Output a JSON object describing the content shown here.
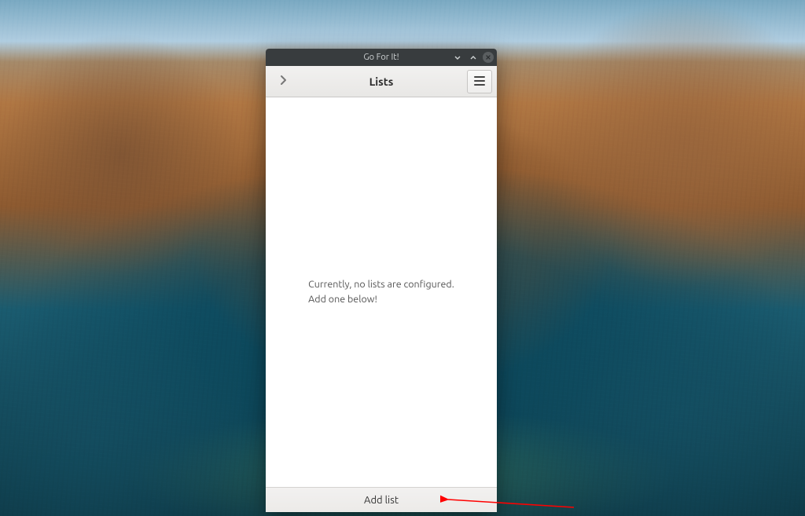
{
  "window": {
    "title": "Go For It!"
  },
  "header": {
    "title": "Lists"
  },
  "empty_state": {
    "line1": "Currently, no lists are configured.",
    "line2": "Add one below!"
  },
  "footer": {
    "add_list_label": "Add list"
  },
  "annotation": {
    "arrow_color": "#ff0000"
  }
}
